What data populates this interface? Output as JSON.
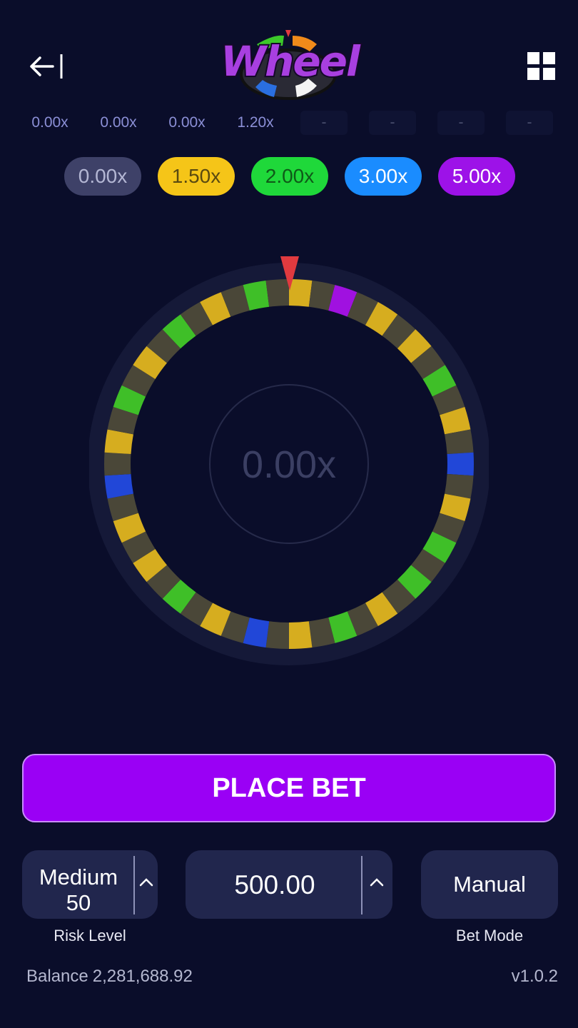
{
  "header": {
    "logo_text": "Wheel",
    "back_icon": "back-arrow-icon",
    "menu_icon": "grid-menu-icon"
  },
  "history": [
    "0.00x",
    "0.00x",
    "0.00x",
    "1.20x",
    "-",
    "-",
    "-",
    "-"
  ],
  "multipliers": [
    {
      "label": "0.00x",
      "color": "#3e4168",
      "text_color": "#b4b7d4"
    },
    {
      "label": "1.50x",
      "color": "#f5c518",
      "text_color": "#5a4a10"
    },
    {
      "label": "2.00x",
      "color": "#1fd83a",
      "text_color": "#0f5a18"
    },
    {
      "label": "3.00x",
      "color": "#1a8cff",
      "text_color": "#ffffff"
    },
    {
      "label": "5.00x",
      "color": "#9d12e8",
      "text_color": "#ffffff"
    }
  ],
  "wheel": {
    "center_value": "0.00x",
    "segment_count": 50,
    "segments": [
      "yellow",
      "gray",
      "purple",
      "gray",
      "yellow",
      "gray",
      "yellow",
      "gray",
      "green",
      "gray",
      "yellow",
      "gray",
      "blue",
      "gray",
      "yellow",
      "gray",
      "green",
      "gray",
      "green",
      "gray",
      "yellow",
      "gray",
      "green",
      "gray",
      "yellow",
      "gray",
      "blue",
      "gray",
      "yellow",
      "gray",
      "green",
      "gray",
      "yellow",
      "gray",
      "yellow",
      "gray",
      "blue",
      "gray",
      "yellow",
      "gray",
      "green",
      "gray",
      "yellow",
      "gray",
      "green",
      "gray",
      "yellow",
      "gray",
      "green",
      "gray"
    ],
    "segment_colors": {
      "gray": "#4a4738",
      "yellow": "#d6ad1f",
      "green": "#3fbf28",
      "blue": "#2147d8",
      "purple": "#a011e0"
    },
    "pointer_color": "#e03a3f"
  },
  "place_bet_label": "PLACE BET",
  "risk": {
    "name": "Medium",
    "value": "50",
    "caption": "Risk Level"
  },
  "bet_amount": "500.00",
  "bet_mode": {
    "value": "Manual",
    "caption": "Bet Mode"
  },
  "balance": {
    "label": "Balance",
    "value": "2,281,688.92"
  },
  "version": "v1.0.2"
}
